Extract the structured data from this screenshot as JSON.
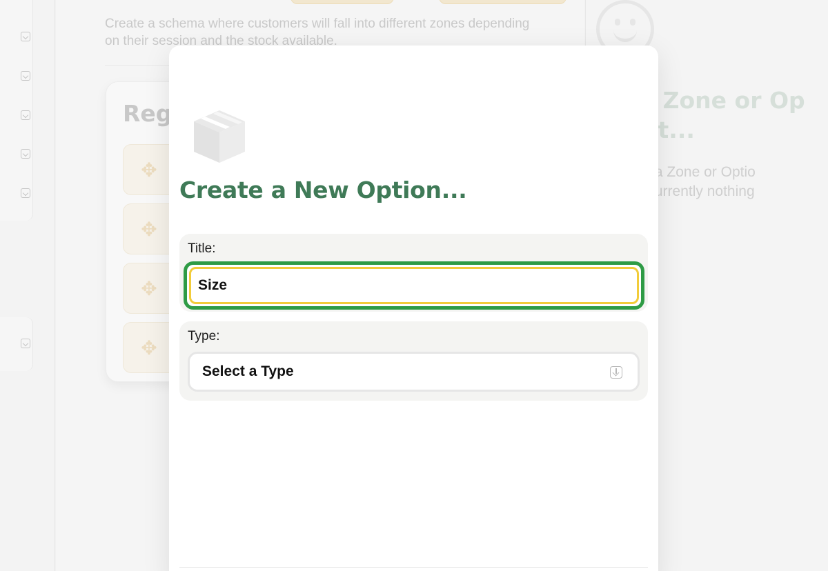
{
  "background": {
    "description": "Create a schema where customers will fall into different zones depending on their session and the stock available.",
    "regions_title": "Reg",
    "right_panel": {
      "title": "ct a Zone or Op\ndit it...",
      "description": "ou edit a Zone or Optio\nhere. Currently nothing"
    }
  },
  "modal": {
    "icon": "box-icon",
    "title": "Create a New Option...",
    "title_field": {
      "label": "Title:",
      "value": "Size"
    },
    "type_field": {
      "label": "Type:",
      "selected": "Select a Type",
      "icon": "chevron-down-box-icon"
    }
  },
  "colors": {
    "accent_green": "#3f7a57",
    "focus_ring": "#2e9b45",
    "input_border": "#f2cc3a"
  }
}
